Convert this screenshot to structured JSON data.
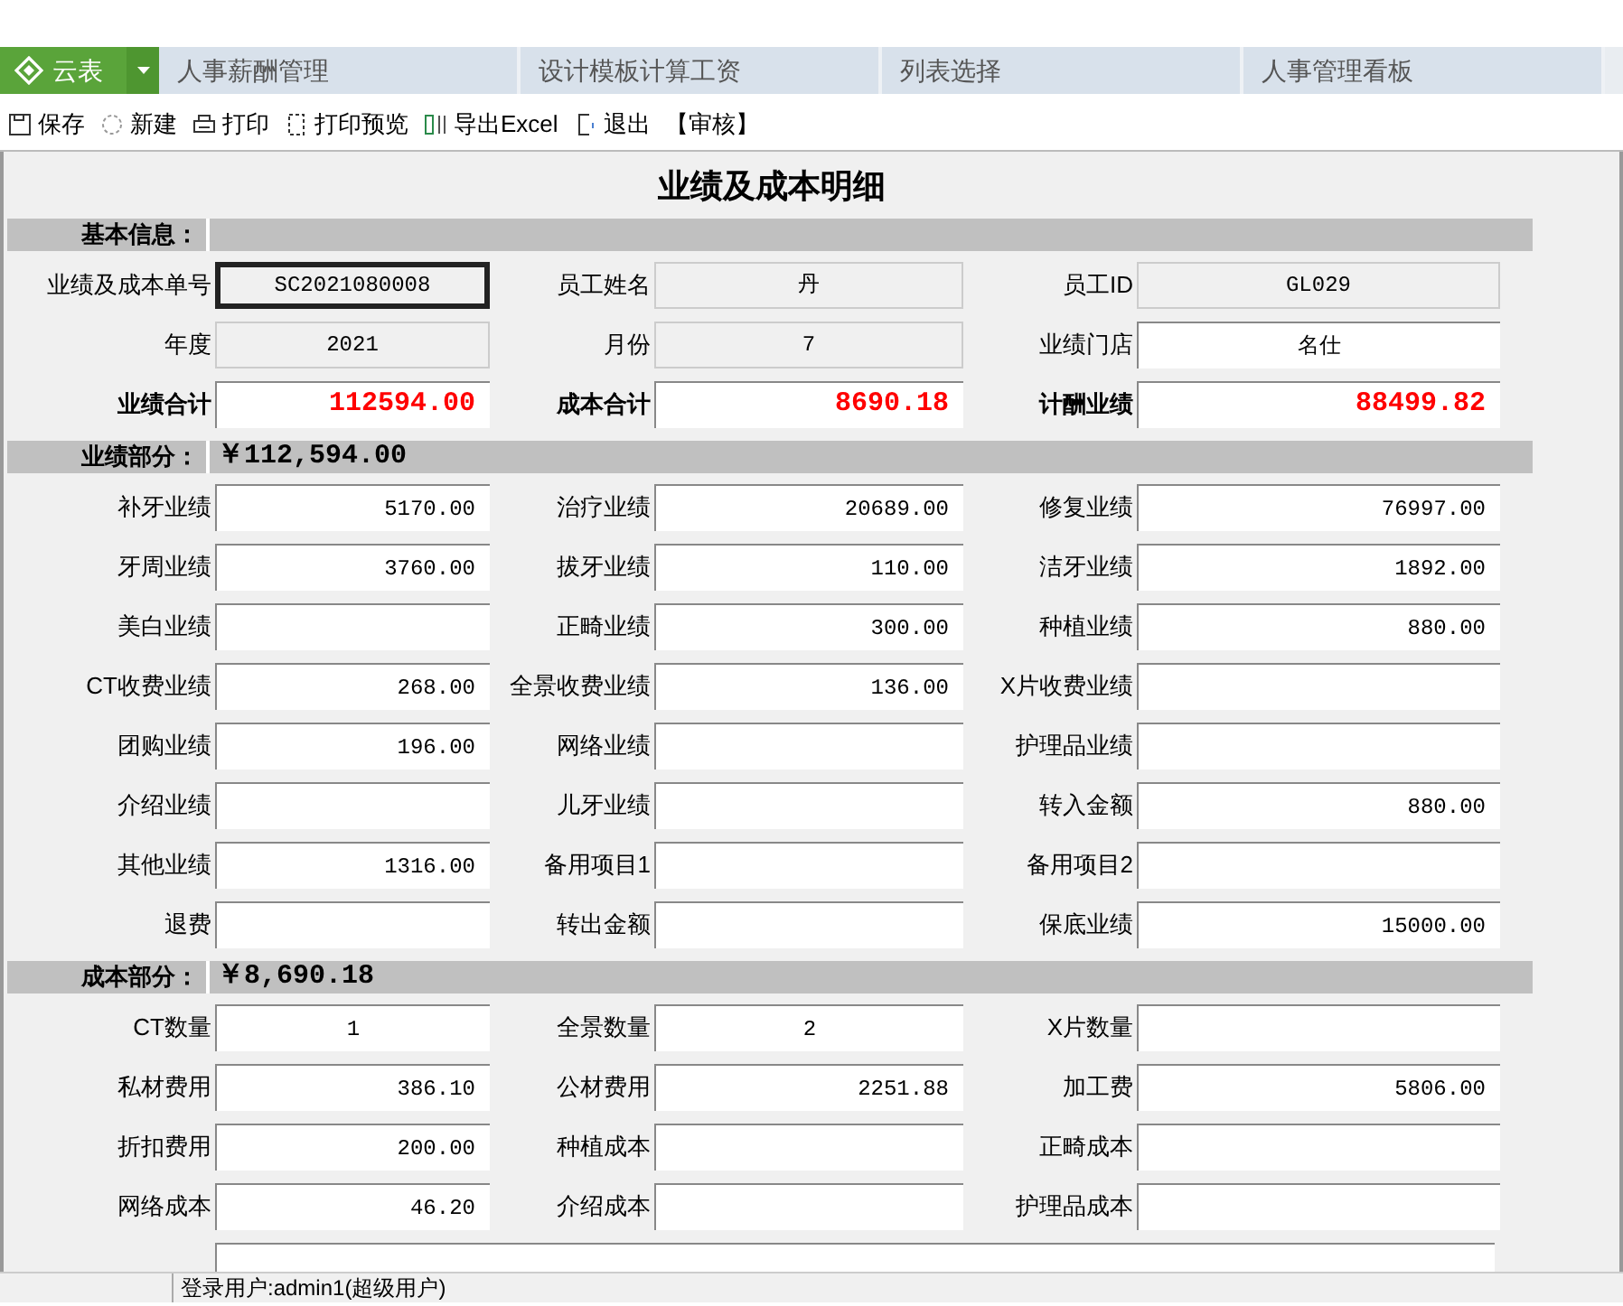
{
  "app_button": {
    "label": "云表"
  },
  "tabs": [
    {
      "label": "人事薪酬管理"
    },
    {
      "label": "设计模板计算工资"
    },
    {
      "label": "列表选择"
    },
    {
      "label": "人事管理看板"
    }
  ],
  "toolbar": [
    {
      "label": "保存",
      "kind": "icon"
    },
    {
      "label": "新建",
      "kind": "icon"
    },
    {
      "label": "打印",
      "kind": "icon"
    },
    {
      "label": "打印预览",
      "kind": "icon"
    },
    {
      "label": "导出Excel",
      "kind": "icon"
    },
    {
      "label": "退出",
      "kind": "icon"
    },
    {
      "label": "【审核】",
      "kind": "text"
    }
  ],
  "form_title": "业绩及成本明细",
  "sections": [
    {
      "title": "基本信息：",
      "rows": [
        [
          {
            "label": "业绩及成本单号",
            "value": "SC2021080008",
            "kind": "readonly",
            "centered": true,
            "focused": true
          },
          {
            "label": "员工姓名",
            "value": "丹",
            "kind": "readonly",
            "centered": true,
            "focused": false
          },
          {
            "label": "员工ID",
            "value": "GL029",
            "kind": "readonly",
            "centered": true,
            "focused": false
          }
        ],
        [
          {
            "label": "年度",
            "value": "2021",
            "kind": "readonly",
            "centered": true,
            "focused": false
          },
          {
            "label": "月份",
            "value": "7",
            "kind": "readonly",
            "centered": true,
            "focused": false
          },
          {
            "label": "业绩门店",
            "value": "名仕",
            "kind": "input",
            "centered": true,
            "focused": false
          }
        ],
        [
          {
            "label": "业绩合计",
            "value": "112594.00",
            "kind": "total",
            "focused": false
          },
          {
            "label": "成本合计",
            "value": "8690.18",
            "kind": "total",
            "focused": false
          },
          {
            "label": "计酬业绩",
            "value": "88499.82",
            "kind": "total",
            "focused": false
          }
        ]
      ]
    },
    {
      "title": "业绩部分：",
      "amount": "￥112,594.00",
      "rows": [
        [
          {
            "label": "补牙业绩",
            "value": "5170.00",
            "kind": "input"
          },
          {
            "label": "治疗业绩",
            "value": "20689.00",
            "kind": "input"
          },
          {
            "label": "修复业绩",
            "value": "76997.00",
            "kind": "input"
          }
        ],
        [
          {
            "label": "牙周业绩",
            "value": "3760.00",
            "kind": "input"
          },
          {
            "label": "拔牙业绩",
            "value": "110.00",
            "kind": "input"
          },
          {
            "label": "洁牙业绩",
            "value": "1892.00",
            "kind": "input"
          }
        ],
        [
          {
            "label": "美白业绩",
            "kind": "input"
          },
          {
            "label": "正畸业绩",
            "value": "300.00",
            "kind": "input"
          },
          {
            "label": "种植业绩",
            "value": "880.00",
            "kind": "input"
          }
        ],
        [
          {
            "label": "CT收费业绩",
            "value": "268.00",
            "kind": "input"
          },
          {
            "label": "全景收费业绩",
            "value": "136.00",
            "kind": "input"
          },
          {
            "label": "X片收费业绩",
            "kind": "input"
          }
        ],
        [
          {
            "label": "团购业绩",
            "value": "196.00",
            "kind": "input"
          },
          {
            "label": "网络业绩",
            "kind": "input"
          },
          {
            "label": "护理品业绩",
            "kind": "input"
          }
        ],
        [
          {
            "label": "介绍业绩",
            "kind": "input"
          },
          {
            "label": "儿牙业绩",
            "kind": "input"
          },
          {
            "label": "转入金额",
            "value": "880.00",
            "kind": "input"
          }
        ],
        [
          {
            "label": "其他业绩",
            "value": "1316.00",
            "kind": "input"
          },
          {
            "label": "备用项目1",
            "kind": "input"
          },
          {
            "label": "备用项目2",
            "kind": "input"
          }
        ],
        [
          {
            "label": "退费",
            "kind": "input"
          },
          {
            "label": "转出金额",
            "kind": "input"
          },
          {
            "label": "保底业绩",
            "value": "15000.00",
            "kind": "input"
          }
        ]
      ]
    },
    {
      "title": "成本部分：",
      "amount": "￥8,690.18",
      "rows": [
        [
          {
            "label": "CT数量",
            "value": "1",
            "kind": "input",
            "centered": true
          },
          {
            "label": "全景数量",
            "value": "2",
            "kind": "input",
            "centered": true
          },
          {
            "label": "X片数量",
            "kind": "input"
          }
        ],
        [
          {
            "label": "私材费用",
            "value": "386.10",
            "kind": "input"
          },
          {
            "label": "公材费用",
            "value": "2251.88",
            "kind": "input"
          },
          {
            "label": "加工费",
            "value": "5806.00",
            "kind": "input"
          }
        ],
        [
          {
            "label": "折扣费用",
            "value": "200.00",
            "kind": "input"
          },
          {
            "label": "种植成本",
            "kind": "input"
          },
          {
            "label": "正畸成本",
            "kind": "input"
          }
        ],
        [
          {
            "label": "网络成本",
            "value": "46.20",
            "kind": "input"
          },
          {
            "label": "介绍成本",
            "kind": "input"
          },
          {
            "label": "护理品成本",
            "kind": "input"
          }
        ],
        [
          {
            "kind": "wide"
          }
        ]
      ]
    }
  ],
  "status_bar": {
    "user": "登录用户:admin1(超级用户)"
  }
}
